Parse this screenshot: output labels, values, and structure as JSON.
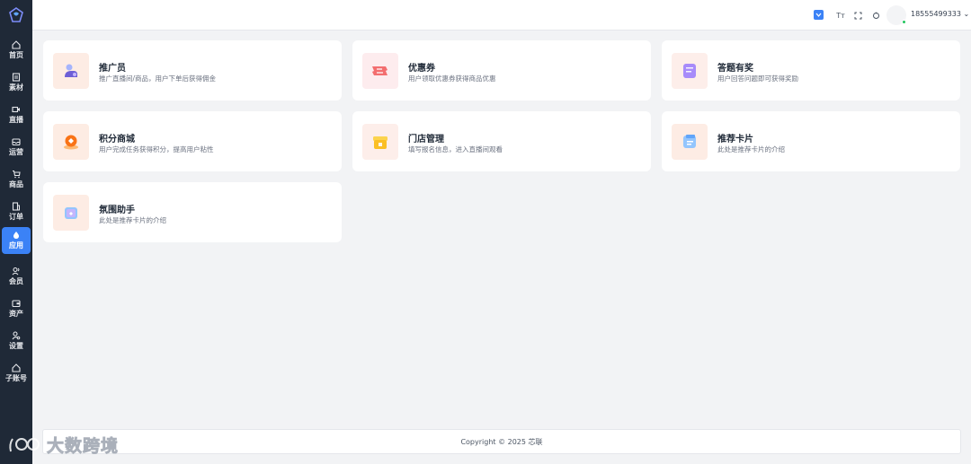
{
  "sidebar": {
    "items": [
      {
        "label": "首页",
        "icon": "home-icon"
      },
      {
        "label": "素材",
        "icon": "material-icon"
      },
      {
        "label": "直播",
        "icon": "video-icon"
      },
      {
        "label": "运营",
        "icon": "inbox-icon"
      },
      {
        "label": "商品",
        "icon": "cart-icon"
      },
      {
        "label": "订单",
        "icon": "order-icon"
      },
      {
        "label": "应用",
        "icon": "drop-icon",
        "active": true
      },
      {
        "label": "会员",
        "icon": "users-icon"
      },
      {
        "label": "资产",
        "icon": "wallet-icon"
      },
      {
        "label": "设置",
        "icon": "settings-user-icon"
      },
      {
        "label": "子账号",
        "icon": "subaccount-icon"
      }
    ]
  },
  "header": {
    "flag_icon": "language-flag-icon",
    "font_icon": "font-size-icon",
    "fullscreen_icon": "fullscreen-icon",
    "refresh_icon": "refresh-icon",
    "font_glyph": "Tт",
    "username": "18555499333"
  },
  "cards": [
    {
      "title": "推广员",
      "desc": "推广直播间/商品，用户下单后获得佣金",
      "icon": "promoter-icon",
      "bg": "#fdece4"
    },
    {
      "title": "优惠券",
      "desc": "用户领取优惠券获得商品优惠",
      "icon": "coupon-icon",
      "bg": "#fdecee"
    },
    {
      "title": "答题有奖",
      "desc": "用户回答问题即可获得奖励",
      "icon": "quiz-icon",
      "bg": "#fdeeea"
    },
    {
      "title": "积分商城",
      "desc": "用户完成任务获得积分，提高用户粘性",
      "icon": "points-mall-icon",
      "bg": "#fdece3"
    },
    {
      "title": "门店管理",
      "desc": "填写报名信息，进入直播间观看",
      "icon": "store-icon",
      "bg": "#fdeeea"
    },
    {
      "title": "推荐卡片",
      "desc": "此处是推荐卡片的介绍",
      "icon": "recommend-card-icon",
      "bg": "#fdece4"
    },
    {
      "title": "氛围助手",
      "desc": "此处是推荐卡片的介绍",
      "icon": "atmosphere-icon",
      "bg": "#fdece4"
    }
  ],
  "footer": {
    "copyright": "Copyright © 2025 芯联"
  },
  "watermark": {
    "text": "大数跨境",
    "logo": "100"
  },
  "colors": {
    "sidebar_bg": "#1f2937",
    "accent": "#3b82f6",
    "page_bg": "#f2f3f5"
  }
}
